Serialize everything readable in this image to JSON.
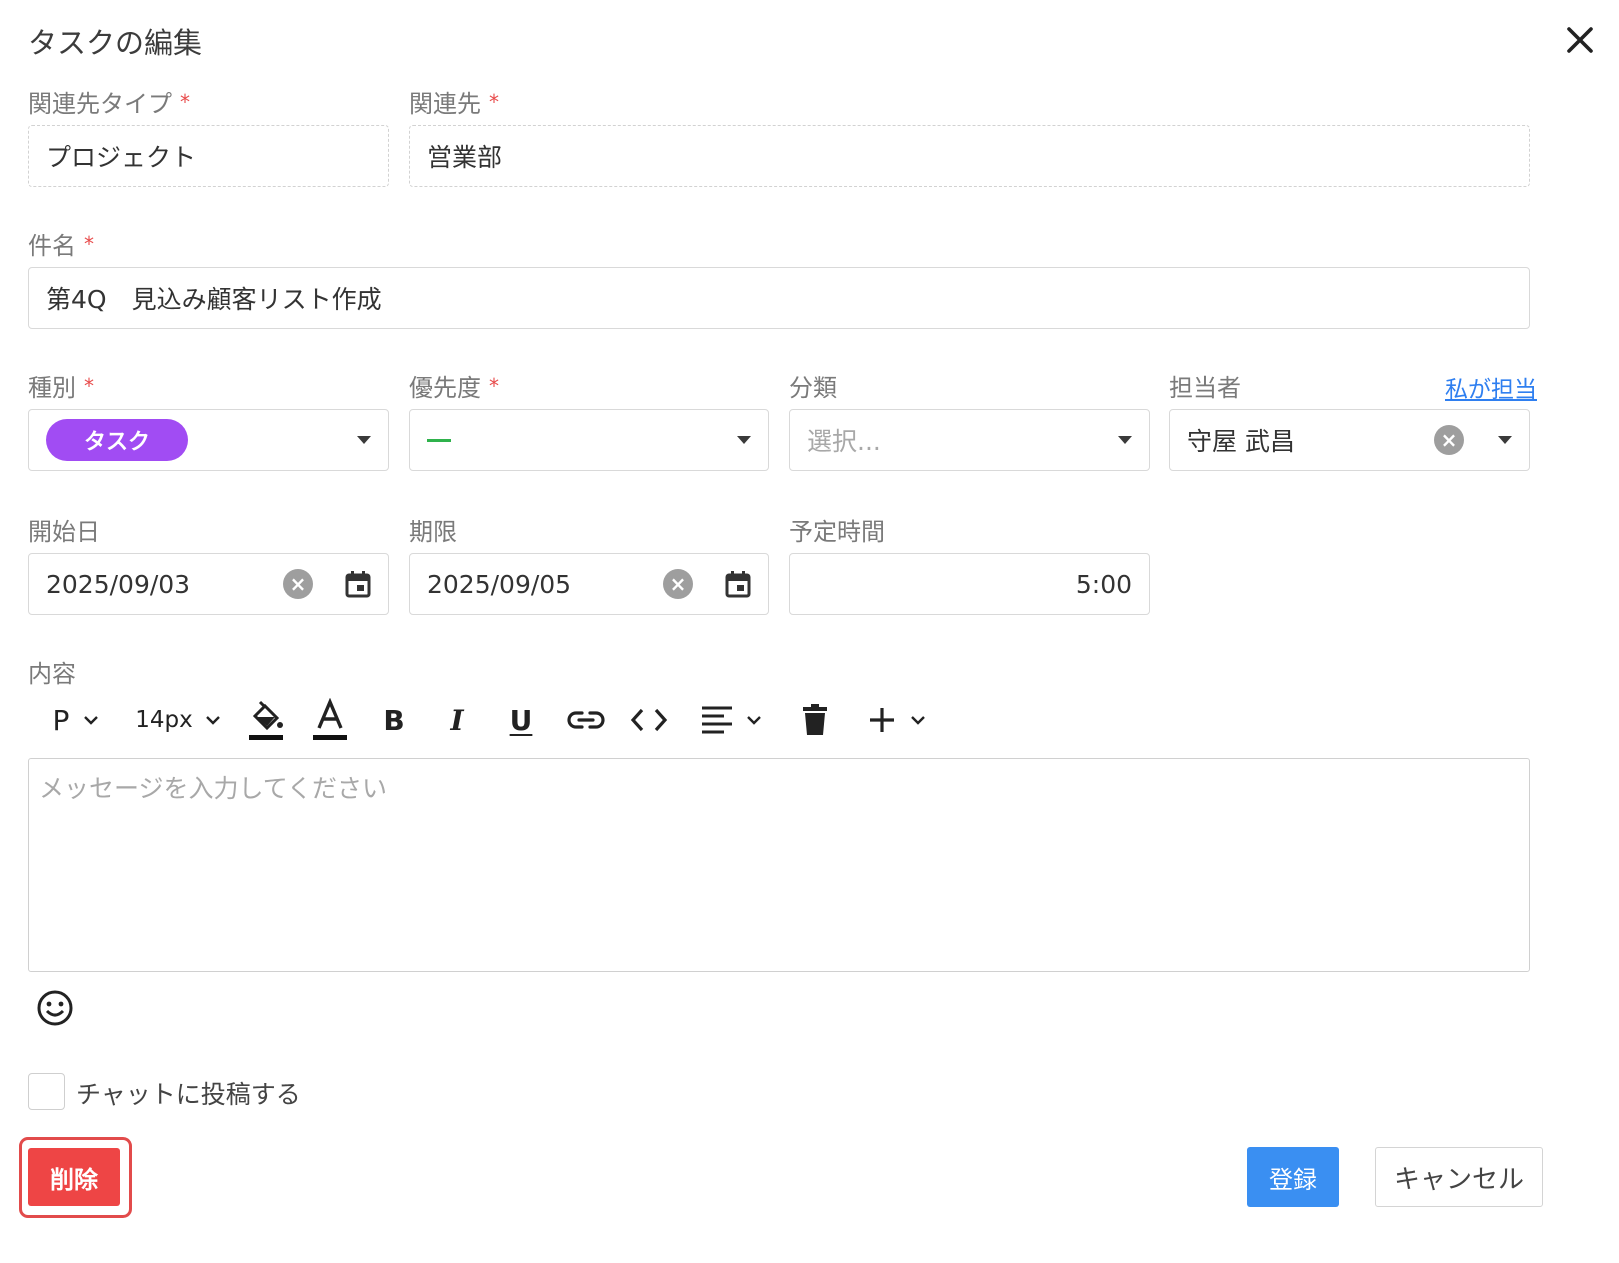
{
  "dialog": {
    "title": "タスクの編集"
  },
  "required_mark": "*",
  "fields": {
    "related_type": {
      "label": "関連先タイプ",
      "value": "プロジェクト"
    },
    "related_to": {
      "label": "関連先",
      "value": "営業部"
    },
    "subject": {
      "label": "件名",
      "value": "第4Q　見込み顧客リスト作成"
    },
    "kind": {
      "label": "種別",
      "value": "タスク",
      "color": "#a14cf3"
    },
    "priority": {
      "label": "優先度",
      "value": "—",
      "color": "#2fb24c"
    },
    "category": {
      "label": "分類",
      "placeholder": "選択..."
    },
    "assignee": {
      "label": "担当者",
      "value": "守屋 武昌",
      "assign_me_link": "私が担当"
    },
    "start_date": {
      "label": "開始日",
      "value": "2025/09/03"
    },
    "due_date": {
      "label": "期限",
      "value": "2025/09/05"
    },
    "planned_time": {
      "label": "予定時間",
      "value": "5:00"
    },
    "content": {
      "label": "内容",
      "placeholder": "メッセージを入力してください"
    }
  },
  "toolbar": {
    "paragraph": "P",
    "font_size": "14px",
    "bold": "B",
    "italic": "I",
    "underline": "U"
  },
  "post_to_chat": {
    "label": "チャットに投稿する",
    "checked": false
  },
  "buttons": {
    "delete": "削除",
    "save": "登録",
    "cancel": "キャンセル"
  },
  "colors": {
    "danger": "#ee4545",
    "primary": "#3a8ff2",
    "link": "#2f7ff0"
  }
}
